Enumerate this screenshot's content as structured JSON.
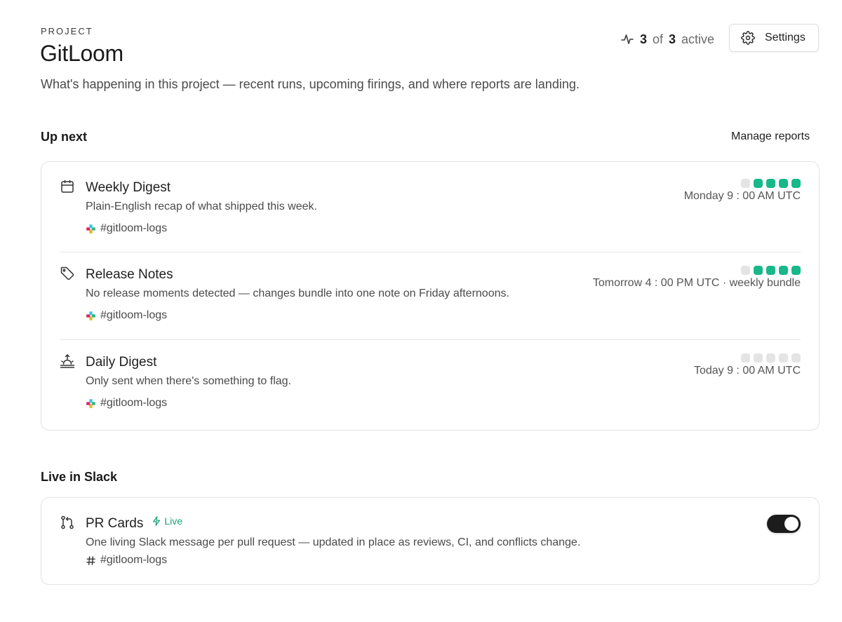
{
  "header": {
    "eyebrow": "PROJECT",
    "title": "GitLoom",
    "subtitle": "What's happening in this project — recent runs, upcoming firings, and where reports are landing.",
    "active": {
      "count": "3",
      "of_label": "of",
      "total": "3",
      "active_label": "active"
    },
    "settings_label": "Settings"
  },
  "up_next": {
    "title": "Up next",
    "manage_label": "Manage reports",
    "reports": [
      {
        "icon": "calendar-icon",
        "name": "Weekly Digest",
        "description": "Plain-English recap of what shipped this week.",
        "channel": "#gitloom-logs",
        "channel_icon": "slack-icon",
        "time": "Monday 9 : 00 AM UTC",
        "runs": [
          false,
          true,
          true,
          true,
          true
        ]
      },
      {
        "icon": "tag-icon",
        "name": "Release Notes",
        "description": "No release moments detected — changes bundle into one note on Friday afternoons.",
        "channel": "#gitloom-logs",
        "channel_icon": "slack-icon",
        "time": "Tomorrow 4 : 00 PM UTC · weekly bundle",
        "runs": [
          false,
          true,
          true,
          true,
          true
        ]
      },
      {
        "icon": "sunrise-icon",
        "name": "Daily Digest",
        "description": "Only sent when there's something to flag.",
        "channel": "#gitloom-logs",
        "channel_icon": "slack-icon",
        "time": "Today 9 : 00 AM UTC",
        "runs": [
          false,
          false,
          false,
          false,
          false
        ]
      }
    ]
  },
  "live_in_slack": {
    "title": "Live in Slack",
    "items": [
      {
        "icon": "pull-request-icon",
        "name": "PR Cards",
        "badge": "Live",
        "badge_icon": "lightning-icon",
        "description": "One living Slack message per pull request — updated in place as reviews, CI, and conflicts change.",
        "channel": "#gitloom-logs",
        "channel_icon": "hash-icon",
        "enabled": true
      }
    ]
  },
  "colors": {
    "accent": "#17b889",
    "live": "#17a178",
    "toggle_on": "#1c1c1c",
    "dot_off": "#e4e4e4"
  }
}
